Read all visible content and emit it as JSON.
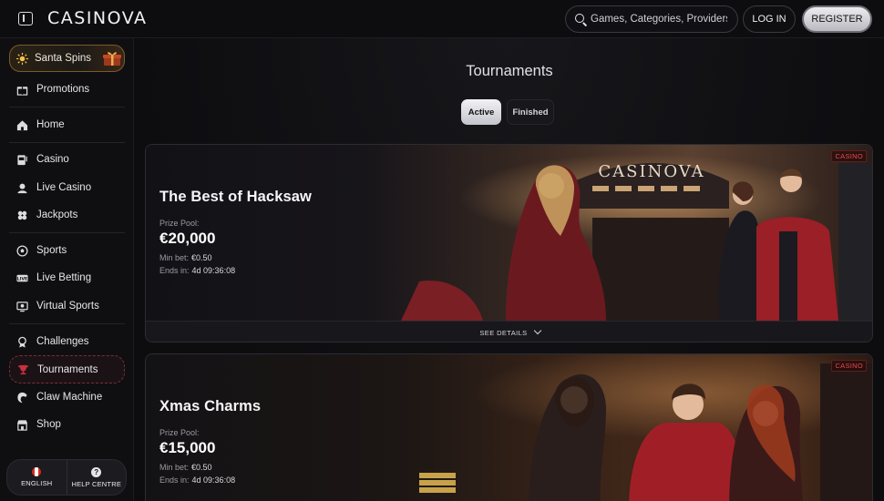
{
  "header": {
    "logo": "CASINOVA",
    "search_placeholder": "Games, Categories, Providers",
    "login_label": "LOG IN",
    "register_label": "REGISTER"
  },
  "sidebar": {
    "promo": {
      "label": "Santa Spins",
      "icon": "sun-icon"
    },
    "items": [
      {
        "label": "Promotions",
        "icon": "gift-icon"
      },
      {
        "label": "Home",
        "icon": "home-icon"
      },
      {
        "label": "Casino",
        "icon": "slot-machine-icon"
      },
      {
        "label": "Live Casino",
        "icon": "dealer-icon"
      },
      {
        "label": "Jackpots",
        "icon": "clover-icon"
      },
      {
        "label": "Sports",
        "icon": "soccer-ball-icon"
      },
      {
        "label": "Live Betting",
        "icon": "live-icon"
      },
      {
        "label": "Virtual Sports",
        "icon": "virtual-sports-icon"
      },
      {
        "label": "Challenges",
        "icon": "medal-icon"
      },
      {
        "label": "Tournaments",
        "icon": "trophy-icon"
      },
      {
        "label": "Claw Machine",
        "icon": "claw-icon"
      },
      {
        "label": "Shop",
        "icon": "shop-icon"
      }
    ],
    "language_label": "ENGLISH",
    "help_label": "HELP CENTRE"
  },
  "main": {
    "title": "Tournaments",
    "tabs": [
      {
        "label": "Active",
        "selected": true
      },
      {
        "label": "Finished",
        "selected": false
      }
    ],
    "tournaments": [
      {
        "name": "The Best of Hacksaw",
        "tag": "CASINO",
        "prize_label": "Prize Pool:",
        "prize_value": "€20,000",
        "min_bet_label": "Min bet:",
        "min_bet_value": "€0.50",
        "ends_label": "Ends in:",
        "ends_value": "4d 09:36:08",
        "details_label": "SEE DETAILS"
      },
      {
        "name": "Xmas Charms",
        "tag": "CASINO",
        "prize_label": "Prize Pool:",
        "prize_value": "€15,000",
        "min_bet_label": "Min bet:",
        "min_bet_value": "€0.50",
        "ends_label": "Ends in:",
        "ends_value": "4d 09:36:08"
      }
    ]
  },
  "colors": {
    "background": "#0c0c0f",
    "active_border": "#7a2d36",
    "tag_red": "#e84a4a",
    "promo_border": "#7a5a2a"
  }
}
